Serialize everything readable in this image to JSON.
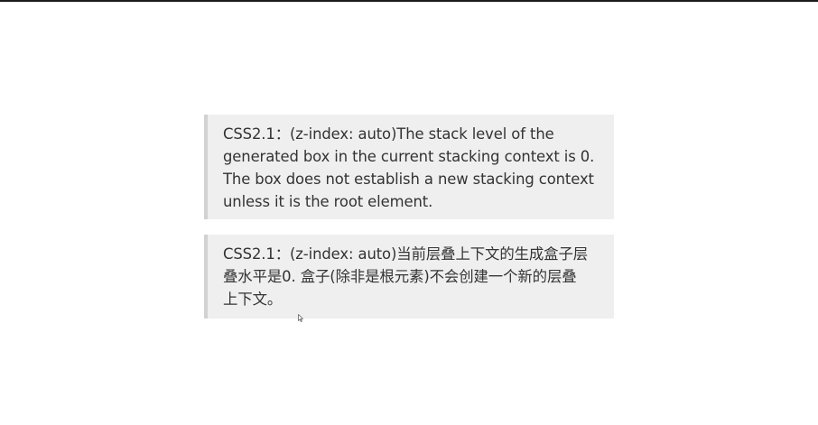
{
  "blockquotes": [
    {
      "text": "CSS2.1：(z-index: auto)The stack level of the\ngenerated box in the current stacking context is 0.\nThe box does not establish a new stacking context\nunless it is the root element."
    },
    {
      "text": "CSS2.1：(z-index: auto)当前层叠上下文的生成盒子层\n叠水平是0. 盒子(除非是根元素)不会创建一个新的层叠\n上下文。"
    }
  ],
  "icons": {
    "cursor": "mouse-pointer-icon"
  },
  "colors": {
    "quote_background": "#efefef",
    "quote_border": "#d2d2d2",
    "text": "#333333"
  }
}
